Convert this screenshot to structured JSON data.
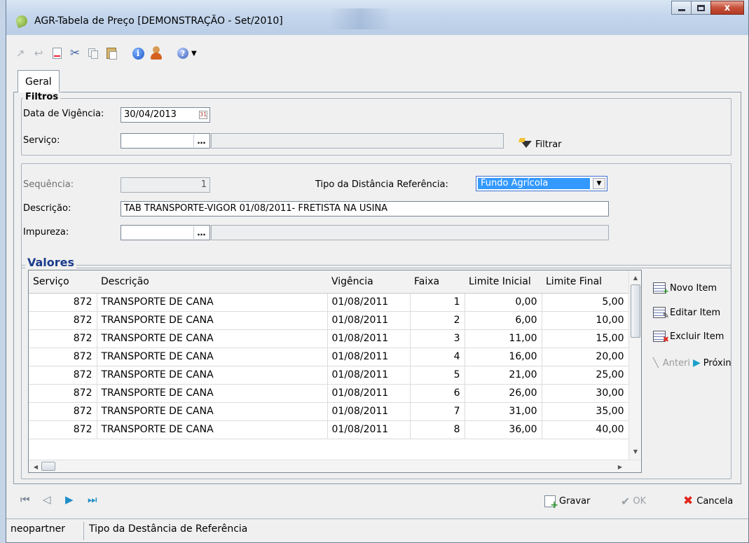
{
  "window": {
    "title": "AGR-Tabela de Preço [DEMONSTRAÇÃO - Set/2010]"
  },
  "toolbar": {
    "icons": [
      "open-icon",
      "back-icon",
      "new-document-icon",
      "cut-icon",
      "copy-icon",
      "paste-icon",
      "info-icon",
      "user-icon",
      "help-icon",
      "dropdown-caret-icon"
    ]
  },
  "tabs": [
    {
      "label": "Geral"
    }
  ],
  "filtros": {
    "legend": "Filtros",
    "data_vigencia_label": "Data de Vigência:",
    "data_vigencia_value": "30/04/2013",
    "servico_label": "Serviço:",
    "servico_code": "",
    "servico_desc": "",
    "filtrar_label": "Filtrar"
  },
  "form": {
    "sequencia_label": "Sequência:",
    "sequencia_value": "1",
    "tipo_distancia_label": "Tipo da Distância Referência:",
    "tipo_distancia_value": "Fundo Agrícola",
    "descricao_label": "Descrição:",
    "descricao_value": "TAB TRANSPORTE-VIGOR 01/08/2011- FRETISTA NA USINA",
    "impureza_label": "Impureza:",
    "impureza_code": "",
    "impureza_desc": ""
  },
  "valores": {
    "legend": "Valores",
    "columns": [
      "Serviço",
      "Descrição",
      "Vigência",
      "Faixa",
      "Limite Inicial",
      "Limite Final"
    ],
    "rows": [
      [
        "872",
        "TRANSPORTE DE CANA",
        "01/08/2011",
        "1",
        "0,00",
        "5,00"
      ],
      [
        "872",
        "TRANSPORTE DE CANA",
        "01/08/2011",
        "2",
        "6,00",
        "10,00"
      ],
      [
        "872",
        "TRANSPORTE DE CANA",
        "01/08/2011",
        "3",
        "11,00",
        "15,00"
      ],
      [
        "872",
        "TRANSPORTE DE CANA",
        "01/08/2011",
        "4",
        "16,00",
        "20,00"
      ],
      [
        "872",
        "TRANSPORTE DE CANA",
        "01/08/2011",
        "5",
        "21,00",
        "25,00"
      ],
      [
        "872",
        "TRANSPORTE DE CANA",
        "01/08/2011",
        "6",
        "26,00",
        "30,00"
      ],
      [
        "872",
        "TRANSPORTE DE CANA",
        "01/08/2011",
        "7",
        "31,00",
        "35,00"
      ],
      [
        "872",
        "TRANSPORTE DE CANA",
        "01/08/2011",
        "8",
        "36,00",
        "40,00"
      ]
    ],
    "actions": {
      "novo_item": "Novo Item",
      "editar_item": "Editar Item",
      "excluir_item": "Excluir Item",
      "anterior": "Anteri",
      "proximo": "Próxin"
    }
  },
  "bottom": {
    "gravar_label": "Gravar",
    "ok_label": "OK",
    "cancela_label": "Cancela"
  },
  "status": {
    "user": "neopartner",
    "message": "Tipo da Destância de Referência"
  },
  "colors": {
    "selection": "#3399ff",
    "legend_blue": "#1a3c8c",
    "cancel_red": "#e0261b"
  }
}
